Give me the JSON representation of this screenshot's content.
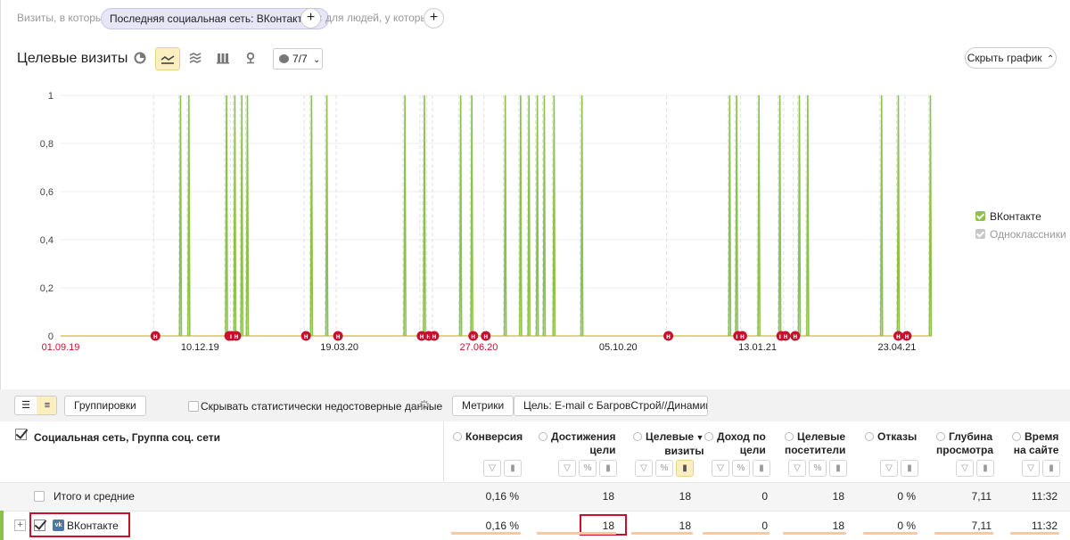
{
  "filters": {
    "prefix": "Визиты, в которых",
    "chip_label": "Последняя социальная сеть: ВКонтакте",
    "suffix": "для людей, у которых"
  },
  "chart_header": {
    "title": "Целевые визиты",
    "comments_count": "7/7",
    "hide_chart_label": "Скрыть график"
  },
  "chart_data": {
    "type": "line",
    "y_ticks": [
      "1",
      "0,8",
      "0,6",
      "0,4",
      "0,2",
      "0"
    ],
    "ylim": [
      0,
      1
    ],
    "x_ticks": [
      {
        "date": "2019-09-01",
        "label": "01.09.19",
        "color": "#c8102e"
      },
      {
        "date": "2019-12-10",
        "label": "10.12.19",
        "color": "#222"
      },
      {
        "date": "2020-03-19",
        "label": "19.03.20",
        "color": "#222"
      },
      {
        "date": "2020-06-27",
        "label": "27.06.20",
        "color": "#c8102e"
      },
      {
        "date": "2020-10-05",
        "label": "05.10.20",
        "color": "#222"
      },
      {
        "date": "2021-01-13",
        "label": "13.01.21",
        "color": "#222"
      },
      {
        "date": "2021-04-23",
        "label": "23.04.21",
        "color": "#222"
      }
    ],
    "date_range": [
      "2019-09-01",
      "2021-05-18"
    ],
    "series": [
      {
        "name": "ВКонтакте",
        "color": "#8bc34a",
        "checked": true,
        "spike_dates": [
          "2019-11-26",
          "2019-12-02",
          "2019-12-29",
          "2020-01-04",
          "2020-01-09",
          "2020-01-13",
          "2020-02-28",
          "2020-03-10",
          "2020-05-05",
          "2020-05-19",
          "2020-06-14",
          "2020-06-22",
          "2020-07-16",
          "2020-07-27",
          "2020-08-02",
          "2020-08-08",
          "2020-08-13",
          "2020-08-20",
          "2020-09-09",
          "2020-12-24",
          "2020-12-29",
          "2021-01-14",
          "2021-01-29",
          "2021-02-12",
          "2021-02-18",
          "2021-04-12",
          "2021-04-24",
          "2021-05-17"
        ]
      },
      {
        "name": "Одноклассники",
        "color": "#bdbdbd",
        "checked": false,
        "spike_dates": []
      }
    ],
    "annotation_dates": [
      "2019-11-08",
      "2019-12-31",
      "2020-01-02",
      "2020-01-05",
      "2020-02-24",
      "2020-03-18",
      "2020-05-17",
      "2020-05-22",
      "2020-05-26",
      "2020-06-23",
      "2020-07-02",
      "2020-11-10",
      "2020-12-30",
      "2021-01-02",
      "2021-01-30",
      "2021-02-02",
      "2021-02-09",
      "2021-04-24",
      "2021-04-30"
    ],
    "annotation_letter": "н",
    "grid": true,
    "legend_position": "right"
  },
  "toolbar": {
    "groupings_label": "Группировки",
    "hide_stat_label": "Скрывать статистически недостоверные данные",
    "metrics_label": "Метрики",
    "goal_label": "Цель: E-mail с БагровСтрой//Динамика"
  },
  "table": {
    "dimension_header": "Социальная сеть, Группа соц. сети",
    "columns": [
      {
        "key": "conv",
        "line1": "Конверсия",
        "line2": ""
      },
      {
        "key": "reach",
        "line1": "Достижения",
        "line2": "цели"
      },
      {
        "key": "visits",
        "line1": "Целевые",
        "line2": "визиты",
        "sorted": "▼"
      },
      {
        "key": "income",
        "line1": "Доход по",
        "line2": "цели"
      },
      {
        "key": "visitors",
        "line1": "Целевые",
        "line2": "посетители"
      },
      {
        "key": "bounce",
        "line1": "Отказы",
        "line2": ""
      },
      {
        "key": "depth",
        "line1": "Глубина",
        "line2": "просмотра"
      },
      {
        "key": "time",
        "line1": "Время",
        "line2": "на сайте"
      }
    ],
    "total_row": {
      "label": "Итого и средние",
      "values": [
        "0,16 %",
        "18",
        "18",
        "0",
        "18",
        "0 %",
        "7,11",
        "11:32"
      ]
    },
    "vk_row": {
      "label": "ВКонтакте",
      "values": [
        "0,16 %",
        "18",
        "18",
        "0",
        "18",
        "0 %",
        "7,11",
        "11:32"
      ]
    }
  },
  "colors": {
    "accent_green": "#8bc34a",
    "annotation_red": "#c8102e",
    "active_yellow": "#fbefbf"
  }
}
